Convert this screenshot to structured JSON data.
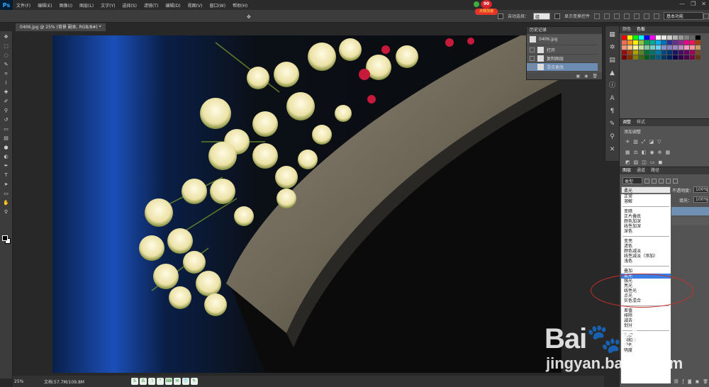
{
  "app": {
    "logo": "Ps"
  },
  "menu": [
    "文件(F)",
    "编辑(E)",
    "图像(I)",
    "图层(L)",
    "文字(Y)",
    "选择(S)",
    "滤镜(T)",
    "编辑(D)",
    "视图(V)",
    "窗口(W)",
    "帮助(H)"
  ],
  "window_controls": {
    "minimize": "—",
    "restore": "❐",
    "close": "✕"
  },
  "options": {
    "auto_select": "自动选择：",
    "auto_select_target": "组",
    "show_transform": "显示变换控件",
    "workspace": "基本功能"
  },
  "badge": {
    "number": "90",
    "text": "点我加速"
  },
  "document": {
    "tab_title": "0406.jpg @ 25% (背景 副本, RGB/8#) *"
  },
  "status": {
    "zoom": "25%",
    "doc_size": "文档:57.7M/109.8M"
  },
  "ime": [
    "S",
    "五",
    "☽",
    "°",
    "⌨",
    "✉",
    "👕",
    "✎"
  ],
  "history": {
    "panel_title": "历史记录",
    "snapshot": "0406.jpg",
    "items": [
      "打开",
      "复制图层",
      "混合更改"
    ]
  },
  "swatches_panel": {
    "tabs": [
      "颜色",
      "色板"
    ]
  },
  "swatch_colors": [
    "#ff0000",
    "#ffff00",
    "#00ff00",
    "#00ffff",
    "#0000ff",
    "#ff00ff",
    "#ffffff",
    "#e6e6e6",
    "#cccccc",
    "#b3b3b3",
    "#999999",
    "#808080",
    "#666666",
    "#000000",
    "#f26c4f",
    "#f7941d",
    "#fff200",
    "#8dc63f",
    "#00a651",
    "#00a99d",
    "#00aeef",
    "#0072bc",
    "#2e3192",
    "#662d91",
    "#92278f",
    "#ec008c",
    "#ed145b",
    "#a0410d",
    "#f69679",
    "#fdc689",
    "#fff799",
    "#c4df9b",
    "#82ca9c",
    "#7accc8",
    "#6dcff6",
    "#8393ca",
    "#8781bd",
    "#a186be",
    "#bd8cbf",
    "#f49ac2",
    "#f5989d",
    "#c69c6d",
    "#9e0b0f",
    "#a0410d",
    "#aba000",
    "#598527",
    "#007236",
    "#00746b",
    "#0076a3",
    "#004a80",
    "#003471",
    "#1b1464",
    "#440e62",
    "#630460",
    "#9e005d",
    "#754c24",
    "#790000",
    "#7b2e00",
    "#827b00",
    "#406618",
    "#005e20",
    "#005952",
    "#005b7f",
    "#003663",
    "#002157",
    "#0d004c",
    "#32004b",
    "#4b0049",
    "#7b0046",
    "#603913"
  ],
  "adjustments": {
    "tabs": [
      "调整",
      "样式"
    ],
    "title": "添加调整"
  },
  "layers": {
    "tabs": [
      "图层",
      "通道",
      "路径"
    ],
    "filter_type": "类型",
    "blend_mode": "柔光",
    "opacity_label": "不透明度：",
    "opacity": "100%",
    "fill_label": "填充：",
    "fill": "100%"
  },
  "blend_dropdown": {
    "groups": [
      [
        "正常",
        "溶解"
      ],
      [
        "变暗",
        "正片叠底",
        "颜色加深",
        "线性加深",
        "深色"
      ],
      [
        "变亮",
        "滤色",
        "颜色减淡",
        "线性减淡（添加）",
        "浅色"
      ],
      [
        "叠加",
        "柔光",
        "强光",
        "亮光",
        "线性光",
        "点光",
        "实色混合"
      ],
      [
        "差值",
        "排除",
        "减去",
        "划分"
      ],
      [
        "色相",
        "饱和度",
        "颜色",
        "明度"
      ]
    ],
    "selected": "柔光"
  },
  "watermark": {
    "main": "Bai🐾du",
    "sub": "jingyan.baidu.com"
  },
  "colors": {
    "accent": "#3b7ee3",
    "ellipse": "#c9302c"
  }
}
